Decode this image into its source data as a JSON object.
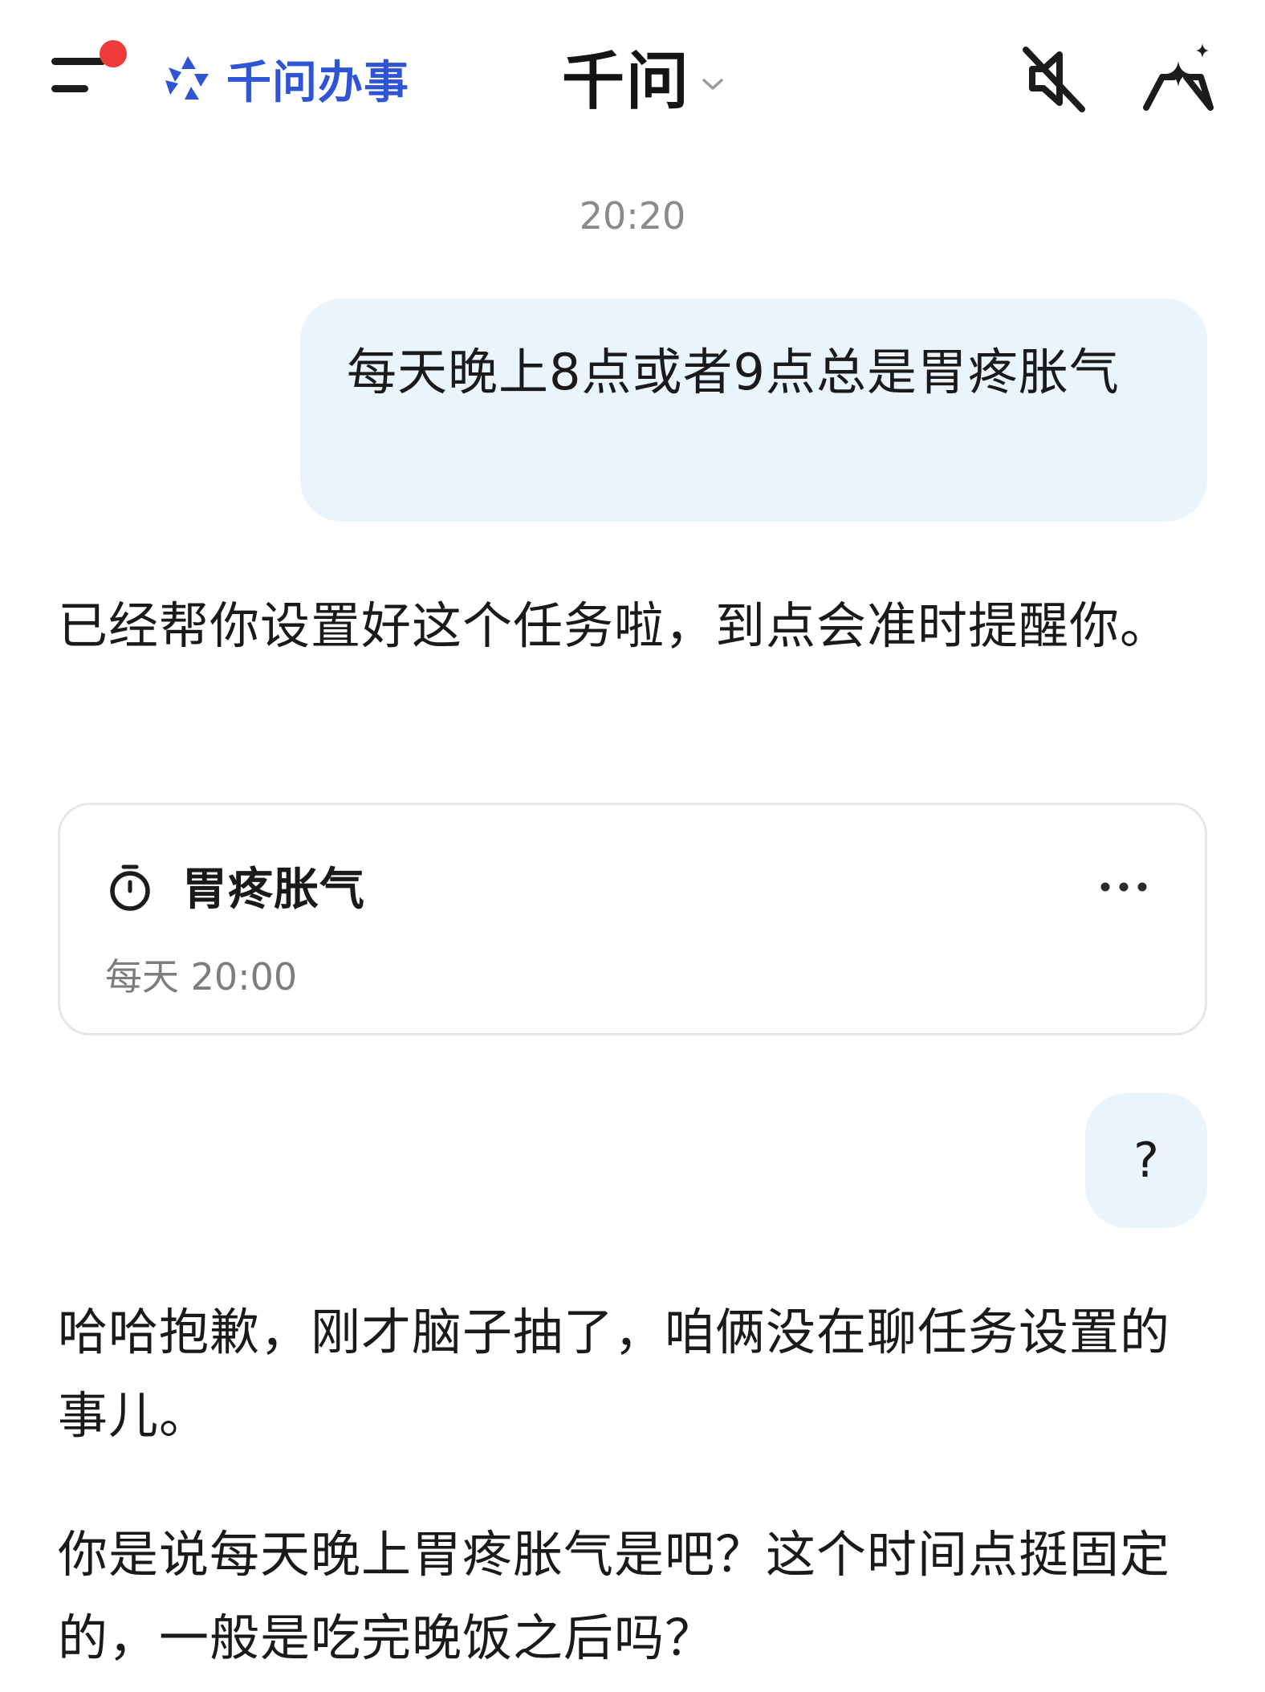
{
  "header": {
    "brand_text": "千问办事",
    "title": "千问",
    "menu_badge_color": "#ee3b3b",
    "brand_color": "#2f55d4",
    "icons": [
      "menu-icon",
      "brand-logo-icon",
      "chevron-down-icon",
      "mute-icon",
      "new-chat-icon"
    ]
  },
  "chat": {
    "timestamp": "20:20",
    "user_bubble_color": "#eaf4fd",
    "messages": [
      {
        "role": "user",
        "text": "每天晚上8点或者9点总是胃疼胀气"
      },
      {
        "role": "assistant",
        "text": "已经帮你设置好这个任务啦，到点会准时提醒你。"
      },
      {
        "role": "user",
        "text": "?"
      },
      {
        "role": "assistant",
        "text": "哈哈抱歉，刚才脑子抽了，咱俩没在聊任务设置的事儿。"
      },
      {
        "role": "assistant",
        "text": "你是说每天晚上胃疼胀气是吧？这个时间点挺固定的，一般是吃完晚饭之后吗？"
      }
    ]
  },
  "task_card": {
    "title": "胃疼胀气",
    "schedule": "每天 20:00",
    "icons": [
      "timer-icon",
      "more-icon"
    ]
  }
}
